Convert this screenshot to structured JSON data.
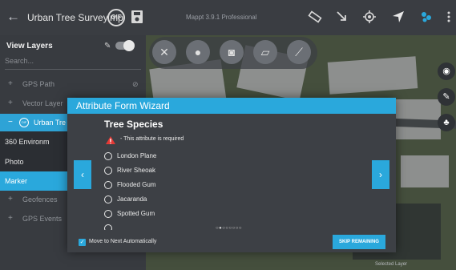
{
  "topbar": {
    "title": "Urban Tree Survey.mp",
    "app_version": "Mappt 3.9.1 Professional",
    "oif_logo_text": "OIF",
    "icons": [
      "back-arrow-icon",
      "save-icon",
      "ruler-icon",
      "route-icon",
      "gps-target-icon",
      "navigation-arrow-icon",
      "layers-icon",
      "more-vert-icon"
    ],
    "colors": {
      "bar": "#3a3d42",
      "accent": "#2aa8dc"
    }
  },
  "sidebar": {
    "header": "View Layers",
    "search_placeholder": "Search...",
    "items": [
      {
        "label": "GPS Path"
      },
      {
        "label": "Vector Layer"
      },
      {
        "label": "Urban Tre"
      },
      {
        "label": "360 Environm"
      },
      {
        "label": "Photo"
      },
      {
        "label": "Marker"
      },
      {
        "label": "Geofences"
      },
      {
        "label": "GPS Events"
      }
    ]
  },
  "map": {
    "tools": [
      "close-icon",
      "marker-icon",
      "camera-icon",
      "polygon-icon",
      "polyline-icon"
    ],
    "right_tools": [
      "compass-icon",
      "edit-icon",
      "tree-icon"
    ],
    "selected_layer_label": "Selected Layer"
  },
  "modal": {
    "title": "Attribute Form Wizard",
    "question": "Tree Species",
    "required_text": "- This attribute is required",
    "options": [
      "London Plane",
      "River Sheoak",
      "Flooded Gum",
      "Jacaranda",
      "Spotted Gum"
    ],
    "page_dots": "○●○○○○○○",
    "move_next_label": "Move to Next Automatically",
    "skip_label": "SKIP REMAINING",
    "prev_glyph": "‹",
    "next_glyph": "›"
  }
}
